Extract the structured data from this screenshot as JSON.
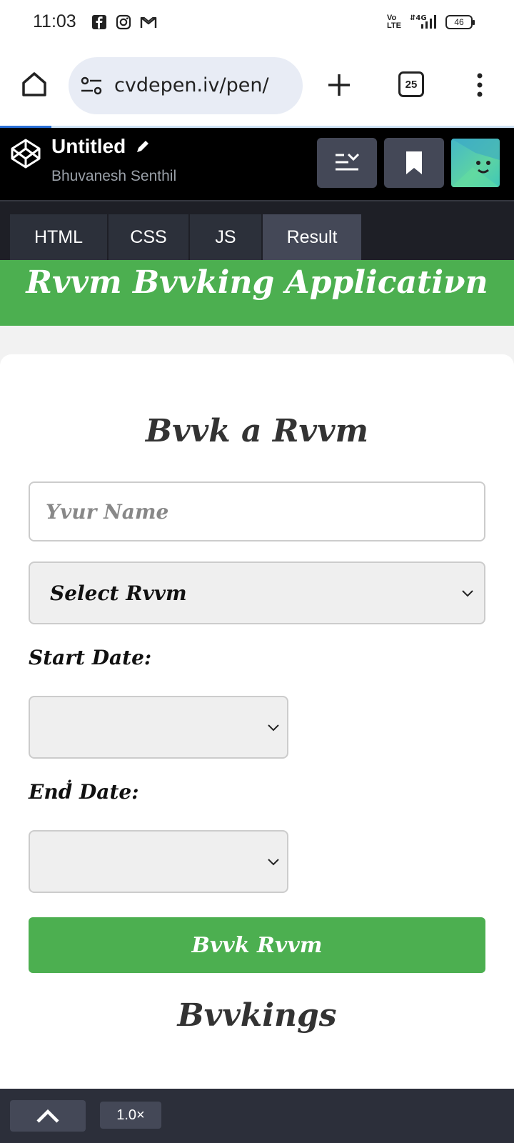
{
  "status_bar": {
    "time": "11:03",
    "battery": "46",
    "network": "4G",
    "volte": "Vo LTE"
  },
  "browser": {
    "url": "cvdepen.iv/pen/",
    "tab_count": "25"
  },
  "codepen": {
    "title": "Untitled",
    "author": "Bhuvanesh Senthil",
    "tabs": [
      {
        "label": "HTML"
      },
      {
        "label": "CSS"
      },
      {
        "label": "JS"
      },
      {
        "label": "Result"
      }
    ],
    "active_tab": "Result"
  },
  "app": {
    "banner_title": "Rvvm Bvvking Applicatiνn",
    "form_title": "Bvvk a Rvvm",
    "name_placeholder": "Yvur Name",
    "room_select": "Select Rvvm",
    "start_label": "Start Date:",
    "end_label": "Enḋ Date:",
    "book_button": "Bvvk Rvvm",
    "bookings_title": "Bvvkings"
  },
  "bottom": {
    "zoom": "1.0×"
  },
  "colors": {
    "accent_green": "#4caf50",
    "codepen_bg": "#000000",
    "tab_active": "#444857"
  }
}
